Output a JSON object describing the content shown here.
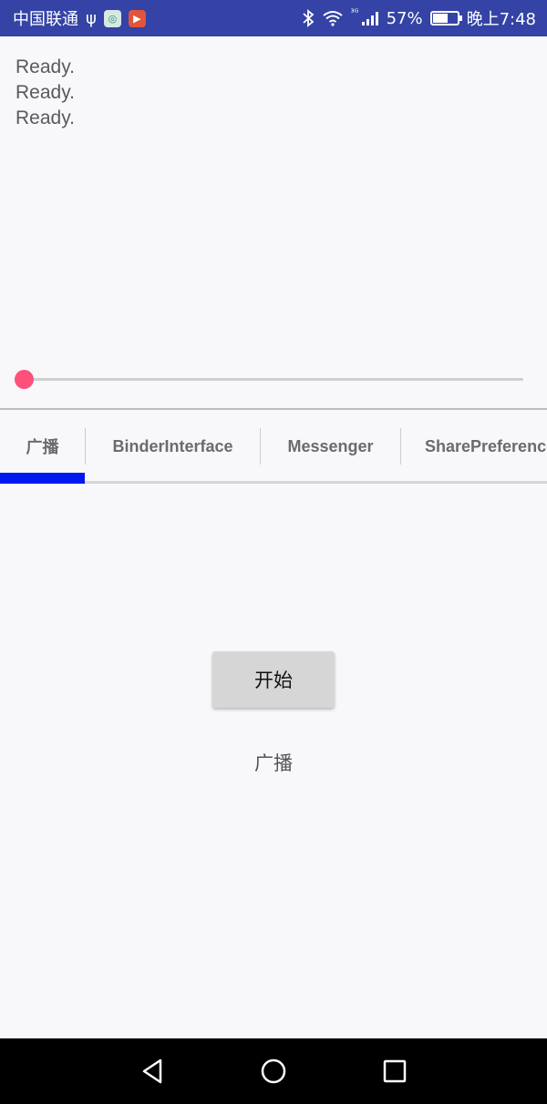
{
  "status_bar": {
    "carrier": "中国联通",
    "usb_symbol": "ψ",
    "network": "³ᴳ",
    "battery": "57%",
    "time": "晚上7:48",
    "colors": {
      "background": "#3443a5"
    }
  },
  "log": {
    "lines": [
      "Ready.",
      "Ready.",
      "Ready."
    ]
  },
  "seekbar": {
    "value": 0,
    "thumb_color": "#ff4f7b"
  },
  "tabs": {
    "items": [
      {
        "label": "广播",
        "selected": true
      },
      {
        "label": "BinderInterface",
        "selected": false
      },
      {
        "label": "Messenger",
        "selected": false
      },
      {
        "label": "SharePreference",
        "selected": false
      }
    ],
    "indicator_color": "#0018f0"
  },
  "content": {
    "start_button": "开始",
    "page_label": "广播"
  },
  "nav_bar": {
    "icons": [
      "back-icon",
      "home-icon",
      "recent-apps-icon"
    ]
  }
}
